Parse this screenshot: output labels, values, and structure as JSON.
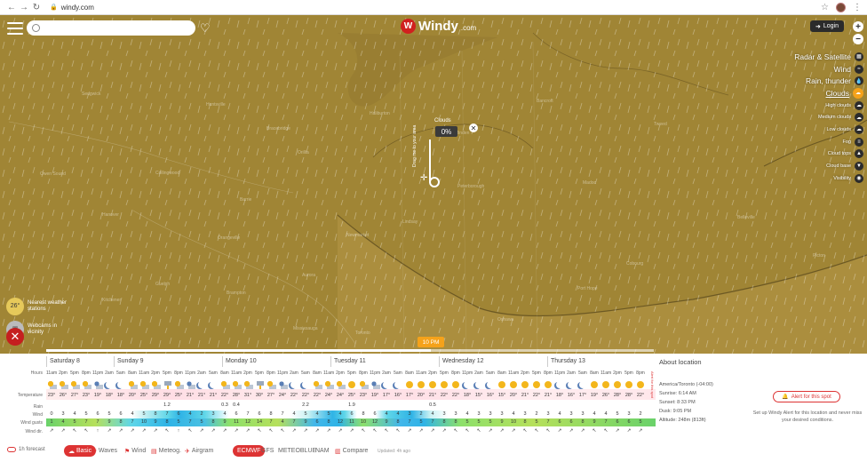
{
  "browser": {
    "back": "←",
    "forward": "→",
    "reload": "↻",
    "url": "windy.com"
  },
  "app": {
    "logo": "Windy",
    "logo_domain": ".com",
    "login": "Login",
    "zoom_in": "+",
    "zoom_out": "−"
  },
  "layers": [
    {
      "label": "Radar & Satellite",
      "size": "big",
      "icon": "▦"
    },
    {
      "label": "Wind",
      "size": "big",
      "icon": "≈"
    },
    {
      "label": "Rain, thunder",
      "size": "big",
      "icon": "💧"
    },
    {
      "label": "Clouds",
      "size": "big",
      "icon": "☁",
      "active": true
    },
    {
      "label": "High clouds",
      "size": "small",
      "icon": "☁"
    },
    {
      "label": "Medium clouds",
      "size": "small",
      "icon": "☁"
    },
    {
      "label": "Low clouds",
      "size": "small",
      "icon": "☁"
    },
    {
      "label": "Fog",
      "size": "small",
      "icon": "≡"
    },
    {
      "label": "Cloud tops",
      "size": "small",
      "icon": "▲"
    },
    {
      "label": "Cloud base",
      "size": "small",
      "icon": "▼"
    },
    {
      "label": "Visibility",
      "size": "small",
      "icon": "◉"
    }
  ],
  "picker": {
    "title": "Clouds",
    "value": "0%",
    "drag_hint": "Drag me to your area",
    "close": "✕"
  },
  "side": {
    "nearest_temp": "26°",
    "nearest_label_1": "Nearest weather",
    "nearest_label_2": "stations",
    "webcams_label_1": "Webcams in",
    "webcams_label_2": "vicinity"
  },
  "close_forecast": "✕",
  "time_bubble": "10 PM",
  "map_labels": [
    "Sedgwick",
    "Huntsville",
    "Bracebridge",
    "Haliburton",
    "Minden",
    "Bancroft",
    "Madoc",
    "Tweed",
    "Belleville",
    "Peterborough",
    "Lindsay",
    "Orillia",
    "Barrie",
    "Newmarket",
    "Aurora",
    "Oshawa",
    "Toronto",
    "Mississauga",
    "Brampton",
    "Orangeville",
    "Guelph",
    "Kitchener",
    "Collingwood",
    "Owen Sound",
    "Hanover",
    "Picton",
    "Cobourg",
    "Port Hope"
  ],
  "forecast": {
    "days": [
      "Saturday 8",
      "Sunday 9",
      "Monday 10",
      "Tuesday 11",
      "Wednesday 12",
      "Thursday 13"
    ],
    "row_labels": {
      "hours": "Hours",
      "temperature": "Temperature",
      "rain": "Rain",
      "wind": "Wind",
      "gusts": "Wind gusts",
      "dir": "Wind dir."
    },
    "units": {
      "temp": "°C",
      "rain": "mm",
      "wind": "kt",
      "gusts": "kt"
    },
    "hours": [
      "11am",
      "2pm",
      "5pm",
      "8pm",
      "11pm",
      "2am",
      "5am",
      "8am",
      "11am",
      "2pm",
      "5pm",
      "8pm",
      "11pm",
      "2am",
      "5am",
      "8am",
      "11am",
      "2pm",
      "5pm",
      "8pm",
      "11pm",
      "2am",
      "5am",
      "8am",
      "11am",
      "2pm",
      "5pm",
      "8pm",
      "11pm",
      "2am",
      "5am",
      "8am",
      "11am",
      "2pm",
      "5pm",
      "8pm",
      "11pm",
      "2am",
      "5am",
      "8am",
      "11am",
      "2pm",
      "5pm",
      "8pm",
      "11pm",
      "2am",
      "5am",
      "8am",
      "11am",
      "2pm",
      "5pm",
      "8pm"
    ],
    "icons": [
      "sc",
      "sc",
      "sc",
      "sc",
      "mc",
      "moon",
      "moon",
      "sc",
      "sc",
      "sc",
      "storm",
      "sc",
      "mc",
      "moon",
      "moon",
      "sc",
      "sc",
      "sc",
      "storm",
      "sc",
      "mc",
      "moon",
      "moon",
      "sc",
      "sc",
      "sc",
      "sun",
      "sc",
      "mc",
      "moon",
      "moon",
      "sun",
      "sun",
      "sun",
      "sun",
      "sun",
      "moon",
      "moon",
      "moon",
      "sun",
      "sun",
      "sun",
      "sun",
      "sun",
      "moon",
      "moon",
      "moon",
      "sun",
      "sun",
      "sun",
      "sun",
      "sun"
    ],
    "temps": [
      "23°",
      "26°",
      "27°",
      "23°",
      "19°",
      "18°",
      "18°",
      "20°",
      "25°",
      "29°",
      "29°",
      "25°",
      "21°",
      "21°",
      "21°",
      "22°",
      "28°",
      "31°",
      "30°",
      "27°",
      "24°",
      "22°",
      "22°",
      "22°",
      "24°",
      "24°",
      "25°",
      "23°",
      "19°",
      "17°",
      "16°",
      "17°",
      "20°",
      "21°",
      "22°",
      "22°",
      "18°",
      "15°",
      "16°",
      "15°",
      "20°",
      "21°",
      "22°",
      "21°",
      "18°",
      "16°",
      "17°",
      "19°",
      "26°",
      "28°",
      "28°",
      "22°"
    ],
    "rain": [
      "",
      "",
      "",
      "",
      "",
      "",
      "",
      "",
      "",
      "",
      "1.2",
      "",
      "",
      "",
      "",
      "0.3",
      "0.4",
      "",
      "",
      "",
      "",
      "",
      "2.2",
      "",
      "",
      "",
      "1.9",
      "",
      "",
      "",
      "",
      "",
      "",
      "0.5",
      "",
      "",
      "",
      "",
      "",
      "",
      "",
      "",
      "",
      "",
      "",
      "",
      "",
      "",
      "",
      "",
      "",
      ""
    ],
    "wind": [
      "0",
      "3",
      "4",
      "5",
      "6",
      "5",
      "6",
      "4",
      "5",
      "8",
      "7",
      "6",
      "4",
      "2",
      "3",
      "4",
      "6",
      "7",
      "6",
      "8",
      "7",
      "4",
      "5",
      "4",
      "5",
      "4",
      "6",
      "8",
      "6",
      "4",
      "4",
      "3",
      "2",
      "4",
      "3",
      "3",
      "4",
      "3",
      "3",
      "3",
      "4",
      "3",
      "2",
      "3",
      "4",
      "3",
      "3",
      "4",
      "4",
      "5",
      "3",
      "2"
    ],
    "gusts": [
      "1",
      "4",
      "5",
      "7",
      "7",
      "9",
      "8",
      "7",
      "10",
      "9",
      "8",
      "5",
      "7",
      "5",
      "8",
      "9",
      "11",
      "12",
      "14",
      "7",
      "4",
      "7",
      "9",
      "6",
      "8",
      "12",
      "11",
      "10",
      "12",
      "9",
      "8",
      "7",
      "5",
      "7",
      "8",
      "8",
      "5",
      "5",
      "5",
      "9",
      "10",
      "8",
      "5",
      "7",
      "6",
      "6",
      "8",
      "9",
      "7",
      "6",
      "6",
      "5"
    ],
    "dir": [
      "↗",
      "↗",
      "↖",
      "↖",
      "↑",
      "↗",
      "↗",
      "↗",
      "↗",
      "↗",
      "↖",
      "↑",
      "↖",
      "↗",
      "↗",
      "↗",
      "↗",
      "↗",
      "↖",
      "↖",
      "↖",
      "↗",
      "↗",
      "↗",
      "↗",
      "↗",
      "↗",
      "↖",
      "↖",
      "↖",
      "↖",
      "↗",
      "↗",
      "↗",
      "↗",
      "↖",
      "↖",
      "↖",
      "↗",
      "↗",
      "↗",
      "↖",
      "↖",
      "↖",
      "↗",
      "↗",
      "↗",
      "↖",
      "↖",
      "↗",
      "↗",
      "↗"
    ],
    "alert_side": "Alert for this spot"
  },
  "location": {
    "header": "About location",
    "tz": "America/Toronto (-04:00)",
    "sunrise": "Sunrise: 6:14 AM",
    "sunset": "Sunset: 8:33 PM",
    "dusk": "Dusk: 9:05 PM",
    "altitude": "Altitude: 248m (813ft)",
    "alert_button": "Alert for this spot",
    "note": "Set up Windy Alert for this location and never miss your desired conditions."
  },
  "toolbar": {
    "toggle": "1h forecast",
    "tabs": [
      {
        "label": "Basic",
        "icon": "☁",
        "active": true
      },
      {
        "label": "Waves",
        "icon": "≈"
      },
      {
        "label": "Wind",
        "icon": "⚑"
      },
      {
        "label": "Meteog.",
        "icon": "▤"
      },
      {
        "label": "Airgram",
        "icon": "✈"
      }
    ],
    "models": [
      {
        "label": "ECMWF",
        "active": true
      },
      {
        "label": "GFS"
      },
      {
        "label": "METEOBLUE"
      },
      {
        "label": "NAM"
      },
      {
        "label": "Compare",
        "icon": "▥"
      }
    ],
    "updated": "Updated: 4h ago"
  },
  "colors": {
    "map_bg": "#a08535",
    "accent": "#d33",
    "orange": "#f5a21a"
  }
}
